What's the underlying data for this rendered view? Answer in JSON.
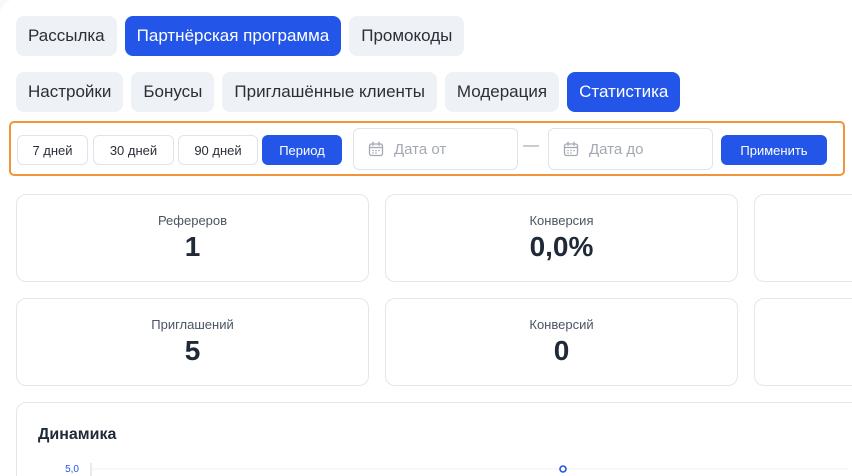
{
  "main_tabs": [
    {
      "label": "Рассылка",
      "active": false
    },
    {
      "label": "Партнёрская программа",
      "active": true
    },
    {
      "label": "Промокоды",
      "active": false
    }
  ],
  "sub_tabs": [
    {
      "label": "Настройки",
      "active": false
    },
    {
      "label": "Бонусы",
      "active": false
    },
    {
      "label": "Приглашённые клиенты",
      "active": false
    },
    {
      "label": "Модерация",
      "active": false
    },
    {
      "label": "Статистика",
      "active": true
    }
  ],
  "filters": {
    "presets": [
      "7 дней",
      "30 дней",
      "90 дней"
    ],
    "period_label": "Период",
    "date_from_placeholder": "Дата от",
    "date_separator": "—",
    "date_to_placeholder": "Дата до",
    "apply_label": "Применить"
  },
  "stats": [
    {
      "label": "Рефереров",
      "value": "1"
    },
    {
      "label": "Конверсия",
      "value": "0,0%"
    },
    {
      "label": "Приглашений",
      "value": "5"
    },
    {
      "label": "Конверсий",
      "value": "0"
    }
  ],
  "chart_data": {
    "type": "line",
    "title": "Динамика",
    "y_tick_labels": [
      "5,0"
    ],
    "ylim_top": 5.0,
    "visible_points": [
      {
        "y": 5.0
      }
    ]
  },
  "colors": {
    "accent": "#2356e8",
    "focus_outline": "#f0953a"
  }
}
